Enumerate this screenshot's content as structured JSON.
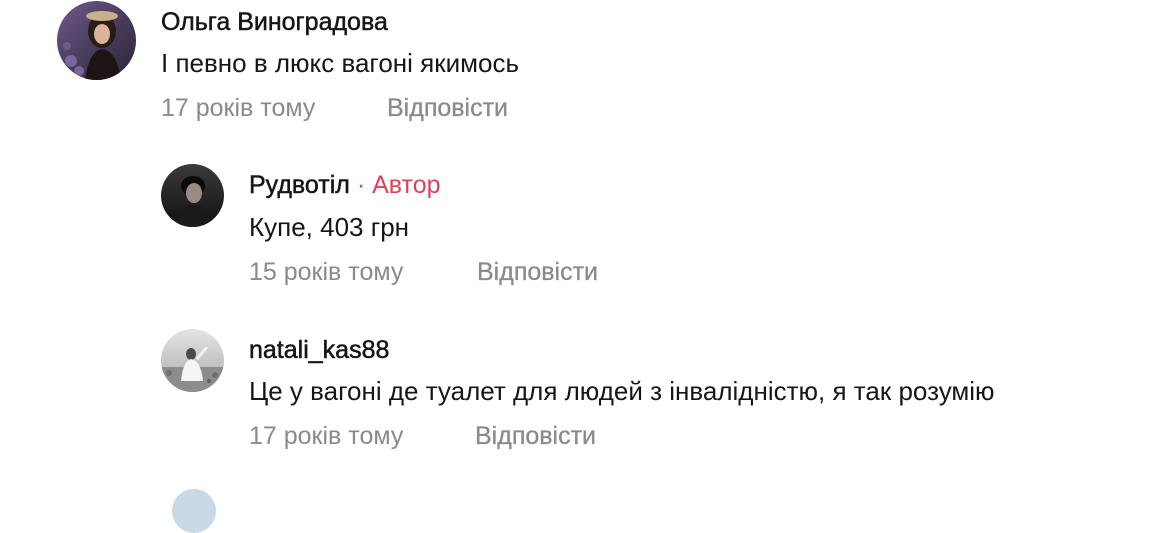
{
  "comments": [
    {
      "author": "Ольга Виноградова",
      "text": "І певно в люкс вагоні якимось",
      "time": "17 років тому",
      "reply": "Відповісти",
      "avatar_icon": "user-photo-avatar"
    },
    {
      "author": "Рудвотіл",
      "badge_separator": "·",
      "badge": "Автор",
      "text": "Купе, 403 грн",
      "time": "15 років тому",
      "reply": "Відповісти",
      "avatar_icon": "user-photo-avatar"
    },
    {
      "author": "natali_kas88",
      "text": "Це у вагоні де туалет для людей з інвалідністю, я так розумію",
      "time": "17 років тому",
      "reply": "Відповісти",
      "avatar_icon": "user-photo-avatar"
    }
  ],
  "colors": {
    "text": "#161616",
    "muted": "#8a8a8a",
    "author_badge": "#e0405c",
    "background": "#ffffff"
  }
}
